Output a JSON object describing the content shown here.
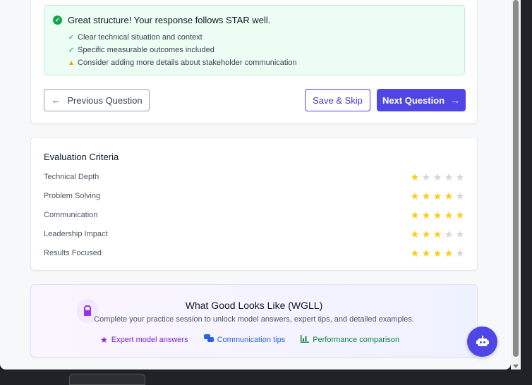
{
  "feedback": {
    "title": "Great structure! Your response follows STAR well.",
    "items": [
      {
        "icon": "check-icon",
        "text": "Clear technical situation and context"
      },
      {
        "icon": "check-icon",
        "text": "Specific measurable outcomes included"
      },
      {
        "icon": "warning-icon",
        "text": "Consider adding more details about stakeholder communication"
      }
    ]
  },
  "nav": {
    "prev_label": "Previous Question",
    "skip_label": "Save & Skip",
    "next_label": "Next Question"
  },
  "evaluation": {
    "title": "Evaluation Criteria",
    "max_stars": 5,
    "criteria": [
      {
        "label": "Technical Depth",
        "rating": 1
      },
      {
        "label": "Problem Solving",
        "rating": 4
      },
      {
        "label": "Communication",
        "rating": 5
      },
      {
        "label": "Leadership Impact",
        "rating": 3
      },
      {
        "label": "Results Focused",
        "rating": 4
      }
    ]
  },
  "wgll": {
    "title": "What Good Looks Like (WGLL)",
    "description": "Complete your practice session to unlock model answers, expert tips, and detailed examples.",
    "features": [
      {
        "icon": "star-icon",
        "label": "Expert model answers"
      },
      {
        "icon": "chat-bubbles-icon",
        "label": "Communication tips"
      },
      {
        "icon": "bar-chart-icon",
        "label": "Performance comparison"
      }
    ]
  },
  "colors": {
    "primary": "#4f46e5",
    "success": "#16a34a",
    "warning": "#f59e0b",
    "star": "#facc15"
  }
}
